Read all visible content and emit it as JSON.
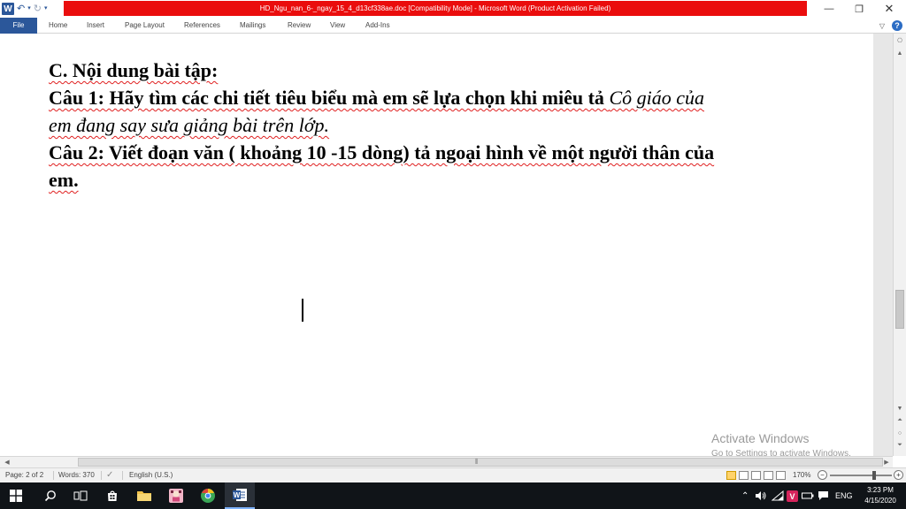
{
  "window": {
    "title": "HD_Ngu_nan_6-_ngay_15_4_d13cf338ae.doc [Compatibility Mode] - Microsoft Word (Product Activation Failed)",
    "app_logo_letter": "W"
  },
  "colors": {
    "title_strip": "#ea0d0d",
    "file_tab": "#2b579a",
    "spellcheck_underline": "#e02020",
    "taskbar": "#101418"
  },
  "ribbon": {
    "tabs": [
      "File",
      "Home",
      "Insert",
      "Page Layout",
      "References",
      "Mailings",
      "Review",
      "View",
      "Add-Ins"
    ]
  },
  "document": {
    "lines": {
      "l1": "C. Nội dung bài tập:",
      "l2a": "Câu 1:  Hãy tìm các chi tiết tiêu biểu mà em sẽ lựa chọn khi miêu tả ",
      "l2b": "Cô giáo của",
      "l3": "em đang say sưa giảng bài trên lớp.",
      "l4": "Câu 2: Viết đoạn văn ( khoảng 10 -15 dòng) tả ngoại hình về một người thân của",
      "l5": "em."
    }
  },
  "watermark": {
    "title": "Activate Windows",
    "subtitle": "Go to Settings to activate Windows."
  },
  "status": {
    "page": "Page: 2 of 2",
    "words": "Words: 370",
    "language": "English (U.S.)",
    "zoom": "170%",
    "zoom_minus": "−",
    "zoom_plus": "+"
  },
  "taskbar": {
    "icons": [
      "windows-start-icon",
      "search-icon",
      "task-view-icon",
      "store-icon",
      "file-explorer-icon",
      "photo-app-icon",
      "chrome-icon",
      "word-icon"
    ],
    "tray_language": "ENG",
    "time": "3:23 PM",
    "date": "4/15/2020"
  }
}
